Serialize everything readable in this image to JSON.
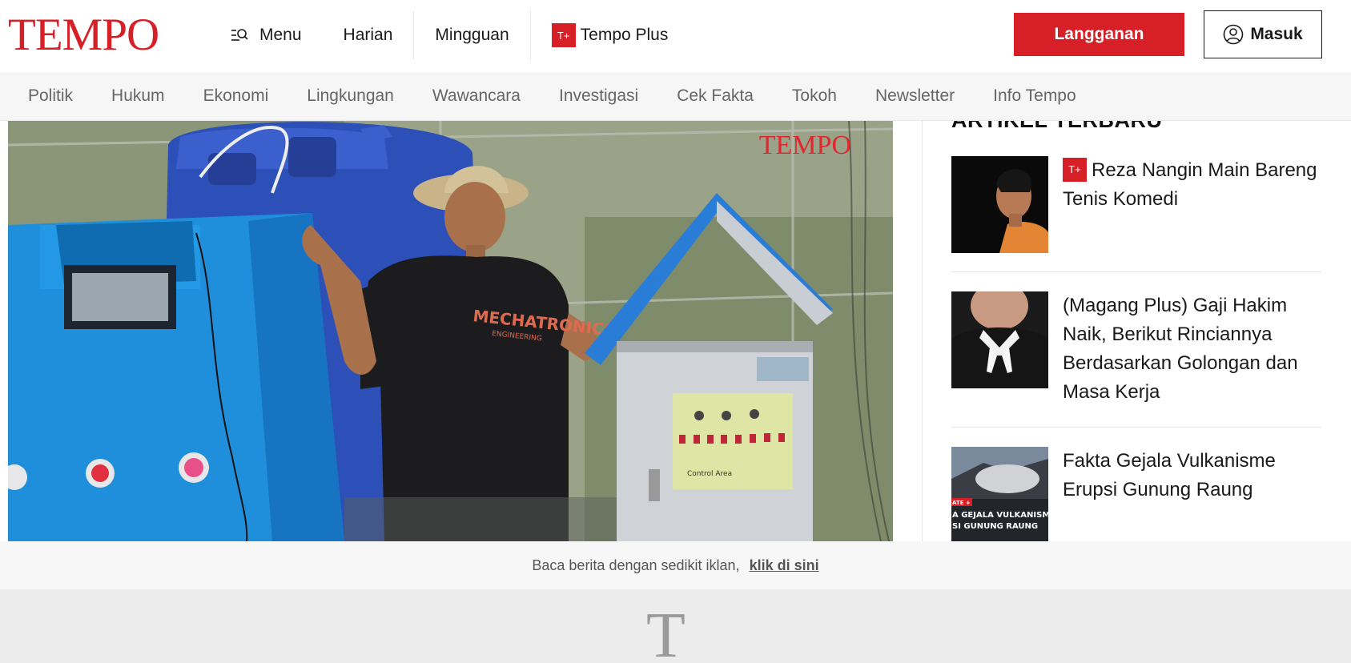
{
  "brand": {
    "logo": "TEMPO",
    "color": "#d61f26"
  },
  "header": {
    "menu_label": "Menu",
    "menu_icon": "menu-search-icon",
    "nav": [
      "Harian",
      "Mingguan"
    ],
    "plus_badge": "T+",
    "plus_label": "Tempo Plus",
    "subscribe_label": "Langganan",
    "login_label": "Masuk",
    "login_icon": "user-icon"
  },
  "categories": [
    "Politik",
    "Hukum",
    "Ekonomi",
    "Lingkungan",
    "Wawancara",
    "Investigasi",
    "Cek Fakta",
    "Tokoh",
    "Newsletter",
    "Info Tempo"
  ],
  "hero": {
    "watermark": "TEMPO",
    "shirt_text": "MECHATRONICS",
    "shirt_subtext": "ENGINEERING",
    "panel_label": "Control Area"
  },
  "sidebar": {
    "title": "ARTIKEL TERBARU",
    "articles": [
      {
        "badge": "T+",
        "title": "Reza Nangin Main Bareng Tenis Komedi"
      },
      {
        "badge": "",
        "title": "(Magang Plus) Gaji Hakim Naik, Berikut Rinciannya Berdasarkan Golongan dan Masa Kerja"
      },
      {
        "badge": "",
        "title": "Fakta Gejala Vulkanisme Erupsi Gunung Raung",
        "thumb_text_1": "A GEJALA VULKANISME",
        "thumb_text_2": "SI GUNUNG RAUNG",
        "thumb_tag": "ATE +"
      }
    ]
  },
  "ad_strip": {
    "text": "Baca berita dengan sedikit iklan,",
    "link": "klik di sini"
  },
  "bottom": {
    "letter": "T"
  }
}
